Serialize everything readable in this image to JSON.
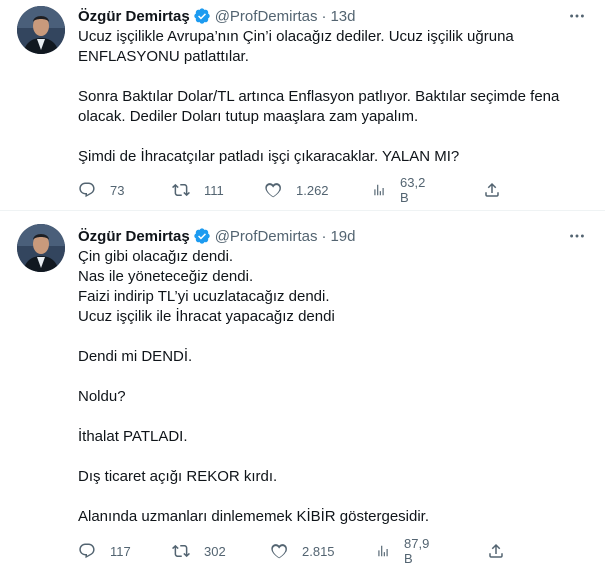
{
  "colors": {
    "text": "#0f1419",
    "secondary": "#536471",
    "verified": "#1d9bf0",
    "border": "#eff3f4"
  },
  "tweets": [
    {
      "name": "Özgür Demirtaş",
      "handle": "@ProfDemirtas",
      "dot": "·",
      "time": "13d",
      "lines": [
        "Ucuz işçilikle Avrupa’nın Çin’i olacağız dediler. Ucuz işçilik uğruna",
        "ENFLASYONU patlattılar.",
        "",
        "Sonra Baktılar Dolar/TL artınca Enflasyon patlıyor. Baktılar seçimde fena",
        "olacak. Dediler Doları tutup maaşlara zam yapalım.",
        "",
        "Şimdi de İhracatçılar patladı işçi çıkaracaklar. YALAN MI?"
      ],
      "stats": {
        "replies": "73",
        "retweets": "111",
        "likes": "1.262",
        "views": "63,2 B"
      }
    },
    {
      "name": "Özgür Demirtaş",
      "handle": "@ProfDemirtas",
      "dot": "·",
      "time": "19d",
      "lines": [
        "Çin gibi olacağız dendi.",
        "Nas ile yöneteceğiz dendi.",
        "Faizi indirip TL’yi ucuzlatacağız dendi.",
        "Ucuz işçilik ile İhracat yapacağız dendi",
        "",
        "Dendi mi DENDİ.",
        "",
        "Noldu?",
        "",
        "İthalat PATLADI.",
        "",
        "Dış ticaret açığı REKOR kırdı.",
        "",
        "Alanında uzmanları dinlememek KİBİR göstergesidir."
      ],
      "stats": {
        "replies": "117",
        "retweets": "302",
        "likes": "2.815",
        "views": "87,9 B"
      }
    }
  ]
}
